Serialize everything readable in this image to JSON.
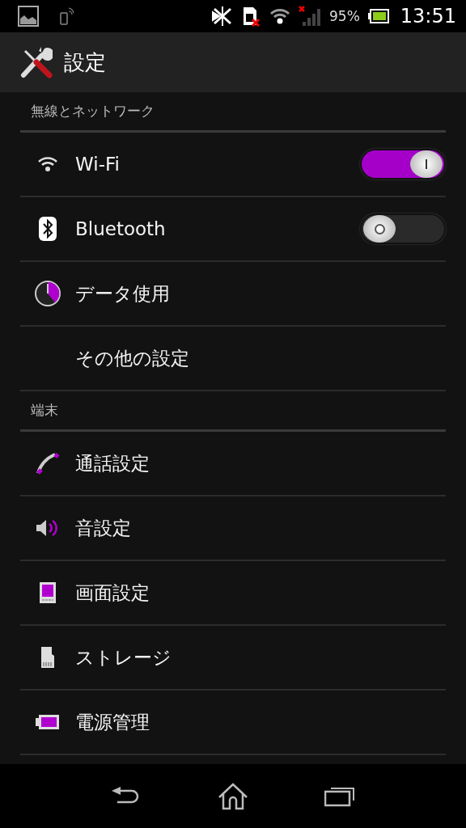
{
  "status_bar": {
    "battery": "95%",
    "time": "13:51"
  },
  "action_bar": {
    "title": "設定"
  },
  "sections": [
    {
      "title": "無線とネットワーク",
      "items": [
        {
          "label": "Wi-Fi",
          "kind": "toggle",
          "on": true
        },
        {
          "label": "Bluetooth",
          "kind": "toggle",
          "on": false
        },
        {
          "label": "データ使用",
          "kind": "plain"
        },
        {
          "label": "その他の設定",
          "kind": "plain"
        }
      ]
    },
    {
      "title": "端末",
      "items": [
        {
          "label": "通話設定",
          "kind": "plain"
        },
        {
          "label": "音設定",
          "kind": "plain"
        },
        {
          "label": "画面設定",
          "kind": "plain"
        },
        {
          "label": "ストレージ",
          "kind": "plain"
        },
        {
          "label": "電源管理",
          "kind": "plain"
        }
      ]
    }
  ]
}
